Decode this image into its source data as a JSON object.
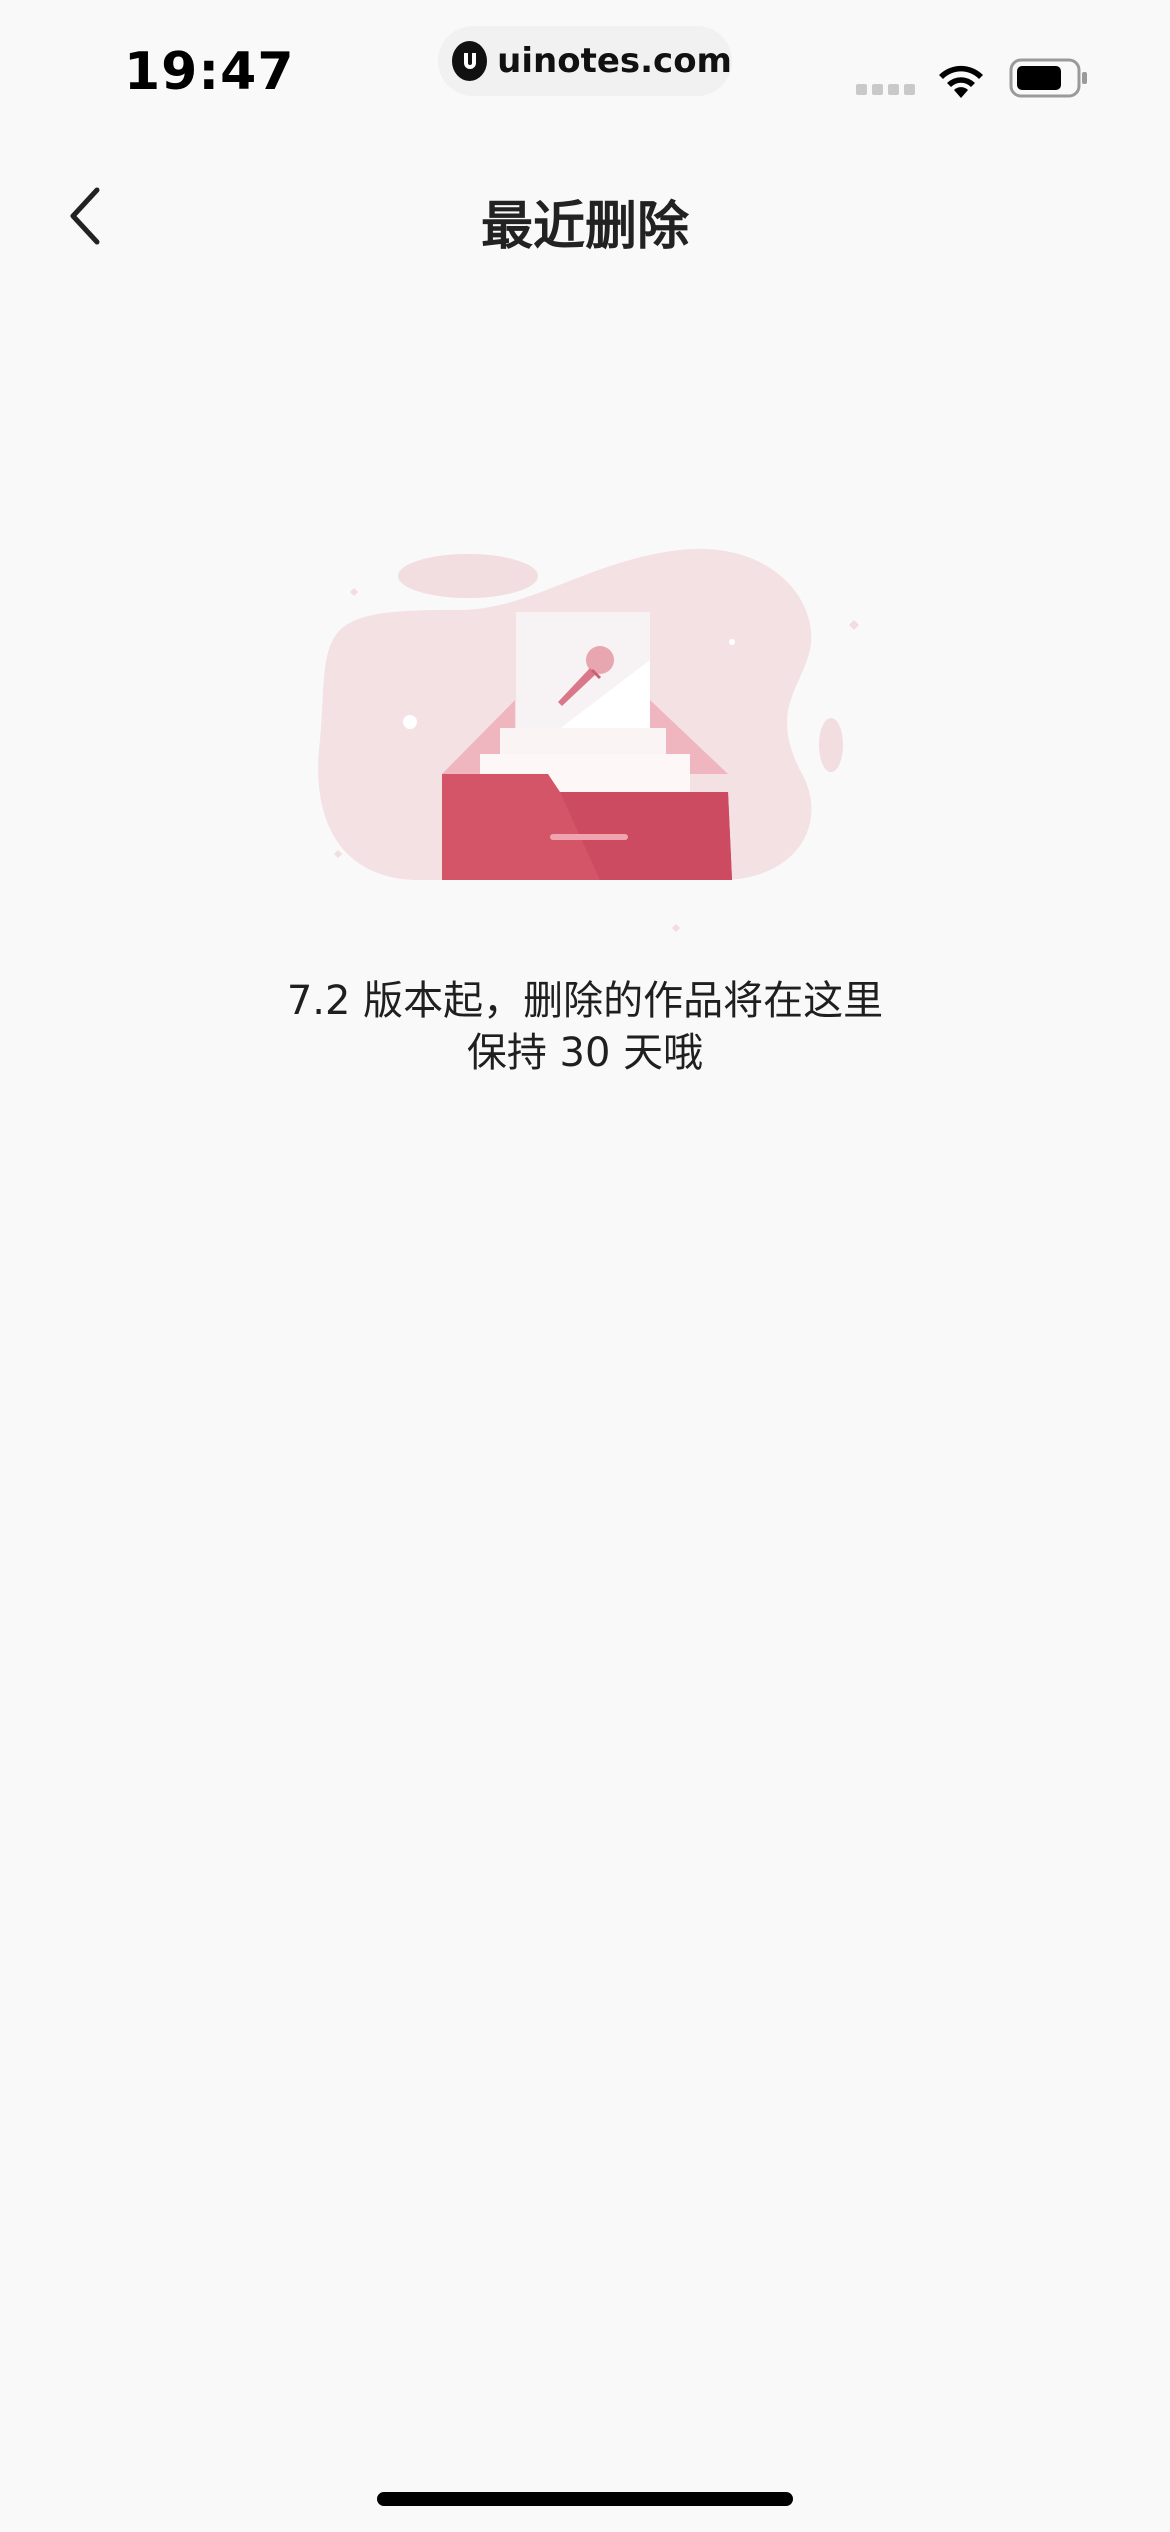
{
  "status_bar": {
    "time": "19:47",
    "url": "uinotes.com",
    "icons": [
      "signal-icon",
      "wifi-icon",
      "battery-icon"
    ]
  },
  "nav": {
    "back_icon": "chevron-left-icon",
    "title": "最近删除"
  },
  "empty_state": {
    "illustration": "drawer-with-microphone-illustration",
    "message_line1": "7.2 版本起，删除的作品将在这里",
    "message_line2": "保持 30 天哦"
  },
  "colors": {
    "background": "#f9f9f9",
    "drawer_red": "#d45468",
    "blob_pink": "#f4e1e4",
    "text": "#1f1f1f"
  }
}
